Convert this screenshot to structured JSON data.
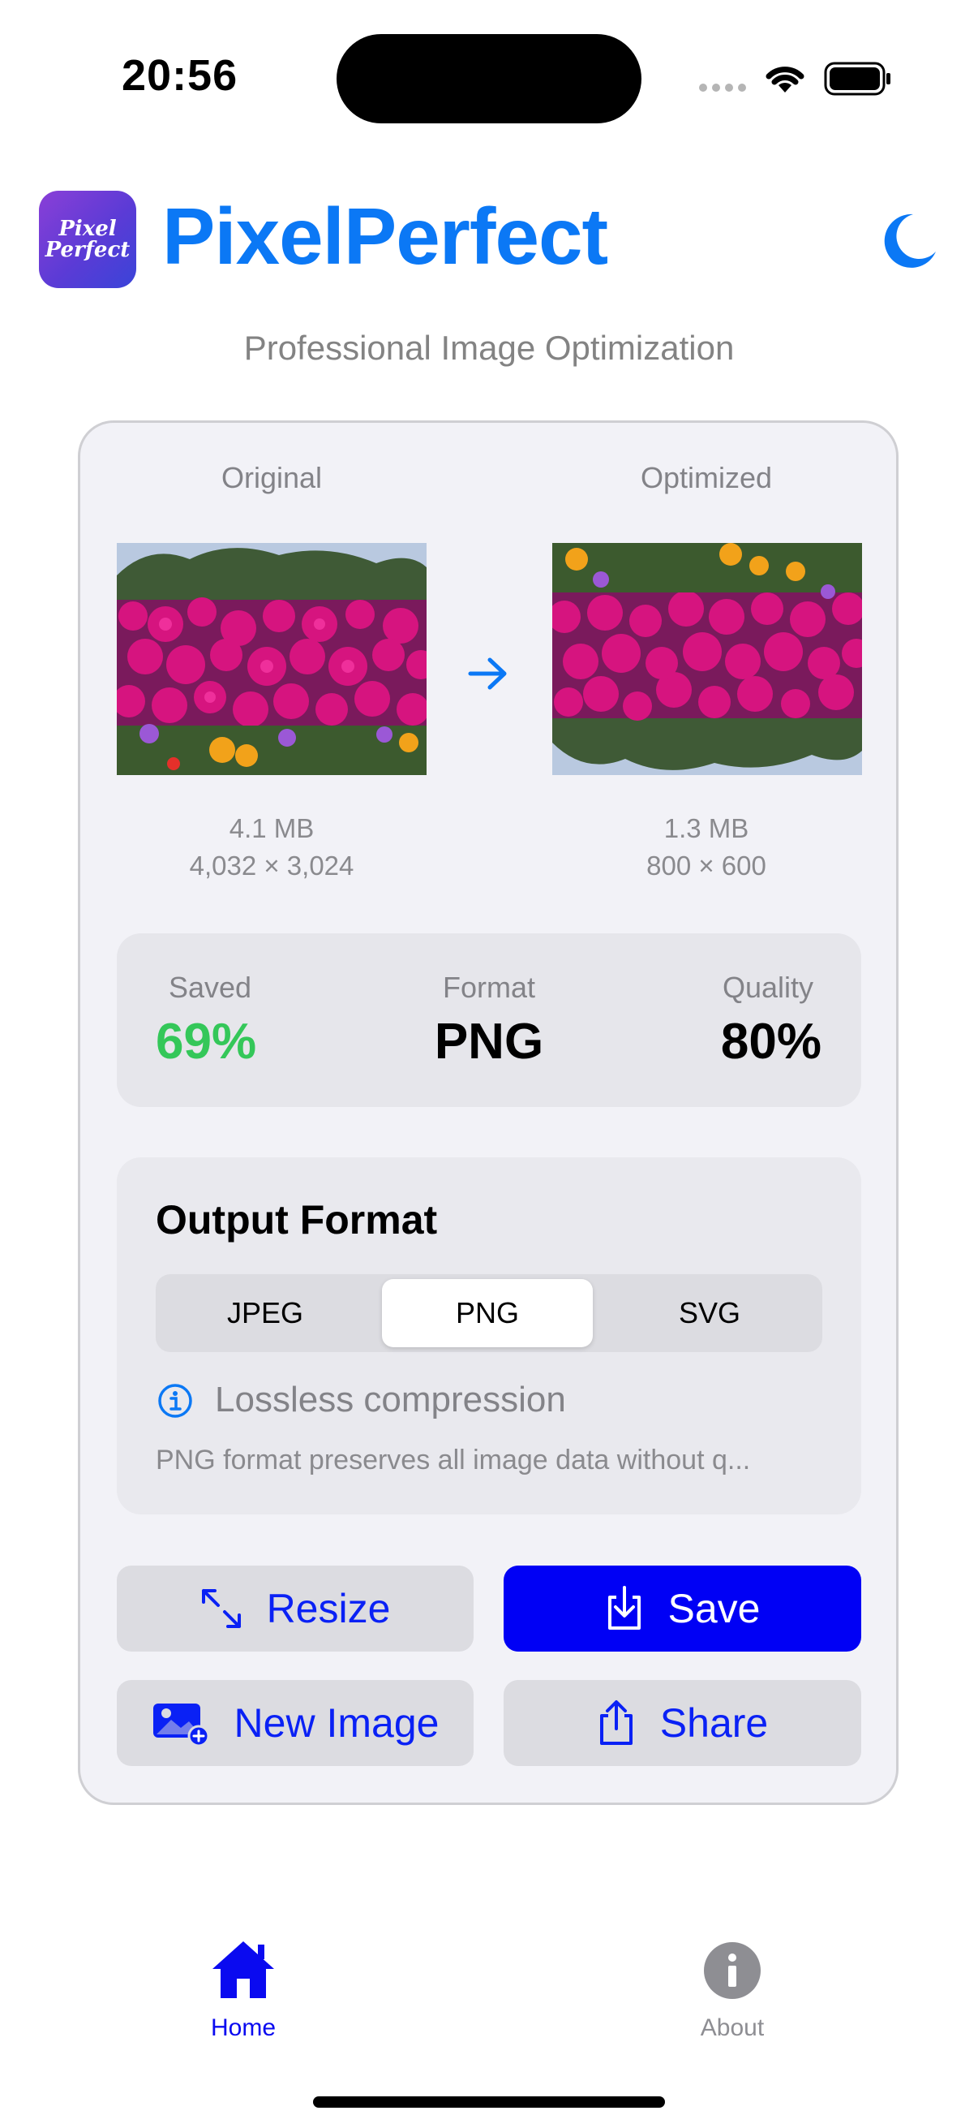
{
  "status": {
    "time": "20:56"
  },
  "header": {
    "logo_text_1": "Pixel",
    "logo_text_2": "Perfect",
    "title": "PixelPerfect",
    "subtitle": "Professional Image Optimization"
  },
  "compare": {
    "original": {
      "label": "Original",
      "size": "4.1 MB",
      "dimensions": "4,032 × 3,024"
    },
    "optimized": {
      "label": "Optimized",
      "size": "1.3 MB",
      "dimensions": "800 × 600"
    }
  },
  "stats": {
    "saved_label": "Saved",
    "saved_value": "69%",
    "format_label": "Format",
    "format_value": "PNG",
    "quality_label": "Quality",
    "quality_value": "80%"
  },
  "output_format": {
    "title": "Output Format",
    "options": [
      "JPEG",
      "PNG",
      "SVG"
    ],
    "selected": "PNG",
    "info_title": "Lossless compression",
    "info_desc": "PNG format preserves all image data without q..."
  },
  "actions": {
    "resize": "Resize",
    "save": "Save",
    "new_image": "New Image",
    "share": "Share"
  },
  "tabbar": {
    "home": "Home",
    "about": "About"
  },
  "colors": {
    "accent": "#0b78f5",
    "primary_button": "#0000f5",
    "saved_green": "#34c759",
    "tab_active": "#0a0af0",
    "tab_inactive": "#8e8e93"
  }
}
